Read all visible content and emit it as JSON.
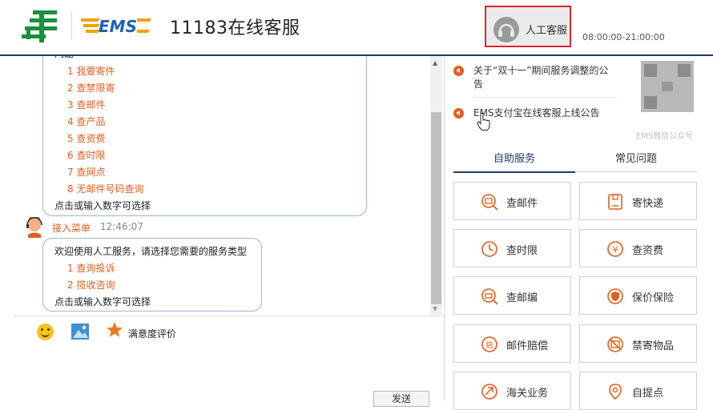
{
  "header": {
    "title": "11183在线客服",
    "agent_button_label": "人工客服",
    "hours": "08:00:00-21:00:00",
    "brand_color": "#1f3a6e",
    "accent_color": "#e35d1e"
  },
  "chat": {
    "messages": [
      {
        "type": "menu",
        "heading": "问题",
        "options": [
          "1 我要寄件",
          "2 查禁限寄",
          "3 查邮件",
          "4 查产品",
          "5 查资费",
          "6 查时限",
          "7 查网点",
          "8 无邮件号码查询"
        ],
        "footer": "点击或输入数字可选择"
      },
      {
        "type": "agent",
        "sender": "接入菜单",
        "time": "12:46:07",
        "intro": "欢迎使用人工服务，请选择您需要的服务类型",
        "options": [
          "1  查询投诉",
          "2  揽收咨询"
        ],
        "footer": "点击或输入数字可选择"
      }
    ]
  },
  "composer": {
    "tools": [
      "emoji-icon",
      "image-icon",
      "star-icon"
    ],
    "rating_label": "满意度评价",
    "send_label": "发送"
  },
  "notices": [
    {
      "text": "关于“双十一”期间服务调整的公告"
    },
    {
      "text": "EMS支付宝在线客服上线公告"
    }
  ],
  "qr_label": "EMS微信公众号",
  "tabs": [
    {
      "label": "自助服务",
      "active": true
    },
    {
      "label": "常见问题",
      "active": false
    }
  ],
  "services": [
    {
      "label": "查邮件",
      "icon": "parcel-search-icon"
    },
    {
      "label": "寄快递",
      "icon": "package-icon"
    },
    {
      "label": "查时限",
      "icon": "clock-icon"
    },
    {
      "label": "查资费",
      "icon": "yen-icon"
    },
    {
      "label": "查邮编",
      "icon": "postcode-search-icon"
    },
    {
      "label": "保价保险",
      "icon": "shield-icon"
    },
    {
      "label": "邮件赔偿",
      "icon": "compensation-icon"
    },
    {
      "label": "禁寄物品",
      "icon": "prohibited-box-icon"
    },
    {
      "label": "海关业务",
      "icon": "customs-icon"
    },
    {
      "label": "自提点",
      "icon": "location-pin-icon"
    }
  ]
}
